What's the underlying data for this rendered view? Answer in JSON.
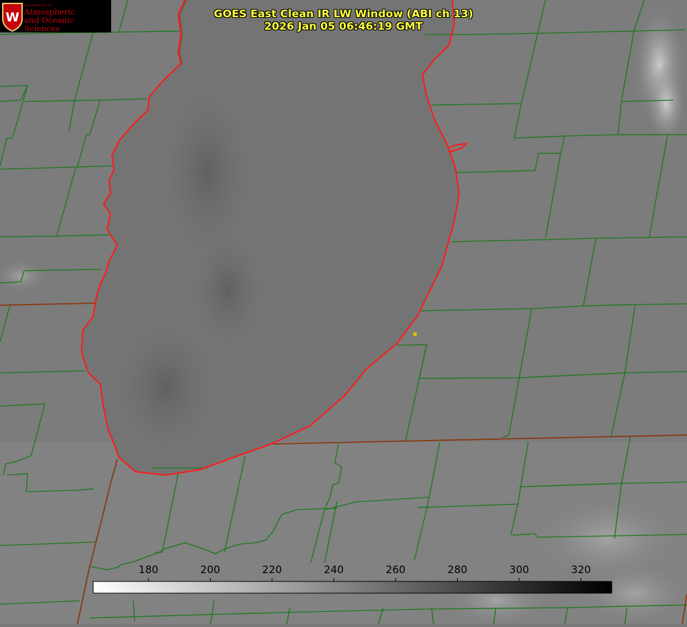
{
  "header": {
    "title_line1": "GOES East Clean IR LW Window (ABI ch 13)",
    "title_line2": "2026 Jan 05 06:46:19 GMT"
  },
  "logo": {
    "emblem_letter": "W",
    "line_small": "Department of",
    "line1": "Atmospheric",
    "line2": "and Oceanic Sciences"
  },
  "colorbar": {
    "ticks": [
      "180",
      "200",
      "220",
      "240",
      "260",
      "280",
      "300",
      "320"
    ],
    "gradient_from": "#ffffff",
    "gradient_to": "#000000"
  },
  "map_colors": {
    "boundaries": "#1e7a1e",
    "state_lines": "#8a3a14",
    "shoreline": "#ff1a1a",
    "station_marker": "#d6c400",
    "lake": "#727272",
    "land": "#7d7d7d",
    "clouds": "#bcbcbc"
  }
}
